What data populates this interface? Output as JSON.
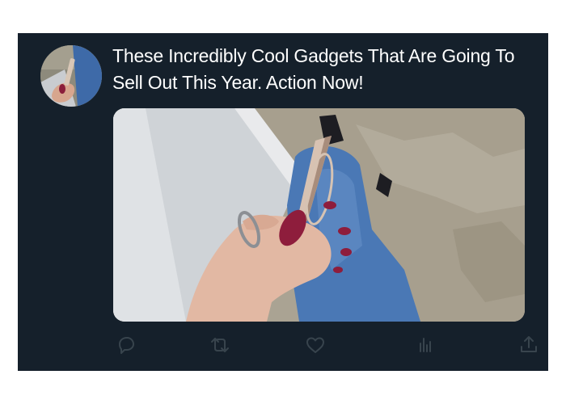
{
  "post": {
    "headline": "These Incredibly Cool Gadgets That Are Going To Sell Out This Year. Action Now!"
  },
  "actions": [
    {
      "name": "reply",
      "icon": "reply-icon"
    },
    {
      "name": "retweet",
      "icon": "retweet-icon"
    },
    {
      "name": "like",
      "icon": "heart-icon"
    },
    {
      "name": "views",
      "icon": "analytics-icon"
    },
    {
      "name": "share",
      "icon": "share-icon"
    }
  ],
  "colors": {
    "background": "#15202b",
    "text": "#ffffff",
    "action_icon": "#38444d"
  }
}
